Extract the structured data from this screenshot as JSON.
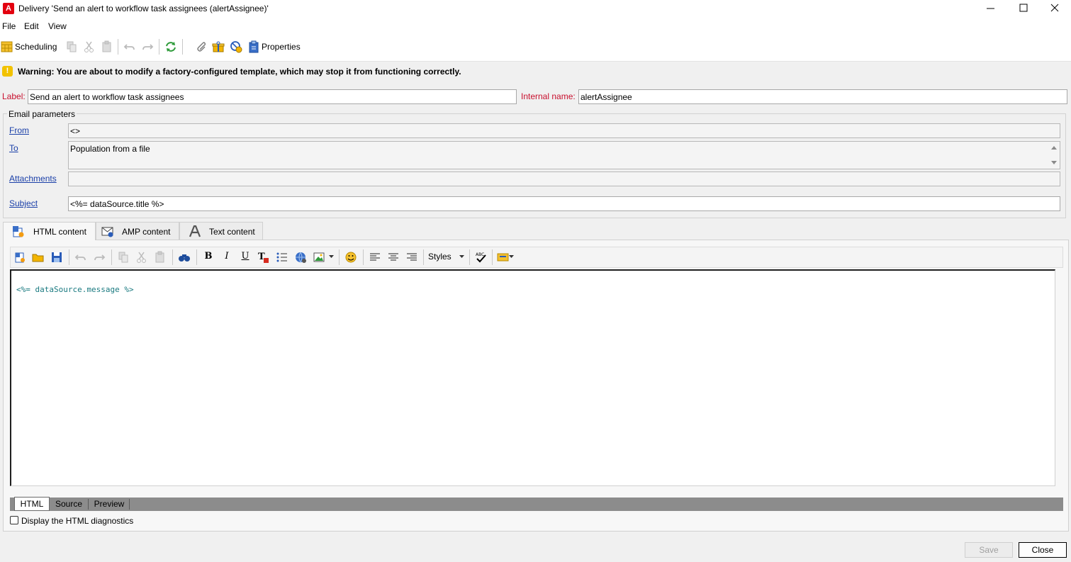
{
  "window": {
    "title": "Delivery 'Send an alert to workflow task assignees (alertAssignee)'",
    "app_icon": "adobe-icon",
    "app_icon_glyph": "A"
  },
  "menu": [
    "File",
    "Edit",
    "View"
  ],
  "toolbar": {
    "scheduling_label": "Scheduling",
    "properties_label": "Properties",
    "icons": [
      "calendar-icon",
      "copy-icon",
      "cut-icon",
      "paste-icon",
      "undo-icon",
      "redo-icon",
      "refresh-icon",
      "attachment-icon",
      "gift-icon",
      "proof-icon",
      "clipboard-icon"
    ]
  },
  "warning": {
    "glyph": "!",
    "text": "Warning: You are about to modify a factory-configured template, which may stop it from functioning correctly."
  },
  "label_field": {
    "label": "Label:",
    "value": "Send an alert to workflow task assignees"
  },
  "internal_name_field": {
    "label": "Internal name:",
    "value": "alertAssignee"
  },
  "email_parameters": {
    "legend": "Email parameters",
    "from_label": "From",
    "from_value": "<>",
    "to_label": "To",
    "to_value": "Population from a file",
    "attachments_label": "Attachments",
    "attachments_value": "",
    "subject_label": "Subject",
    "subject_value": "<%= dataSource.title %>"
  },
  "tabs": [
    {
      "label": "HTML content",
      "icon": "html-content-icon",
      "active": true
    },
    {
      "label": "AMP content",
      "icon": "amp-content-icon",
      "active": false
    },
    {
      "label": "Text content",
      "icon": "text-content-icon",
      "active": false
    }
  ],
  "editor_toolbar": {
    "styles_label": "Styles"
  },
  "editor": {
    "content": "<%= dataSource.message %>"
  },
  "bottom_tabs": [
    "HTML",
    "Source",
    "Preview"
  ],
  "diagnostics_label": "Display the HTML diagnostics",
  "buttons": {
    "save": "Save",
    "close": "Close"
  },
  "colors": {
    "required_label": "#c8102e",
    "link": "#1a3fa8",
    "warning": "#f2c200",
    "editor_text": "#1a7a80"
  }
}
